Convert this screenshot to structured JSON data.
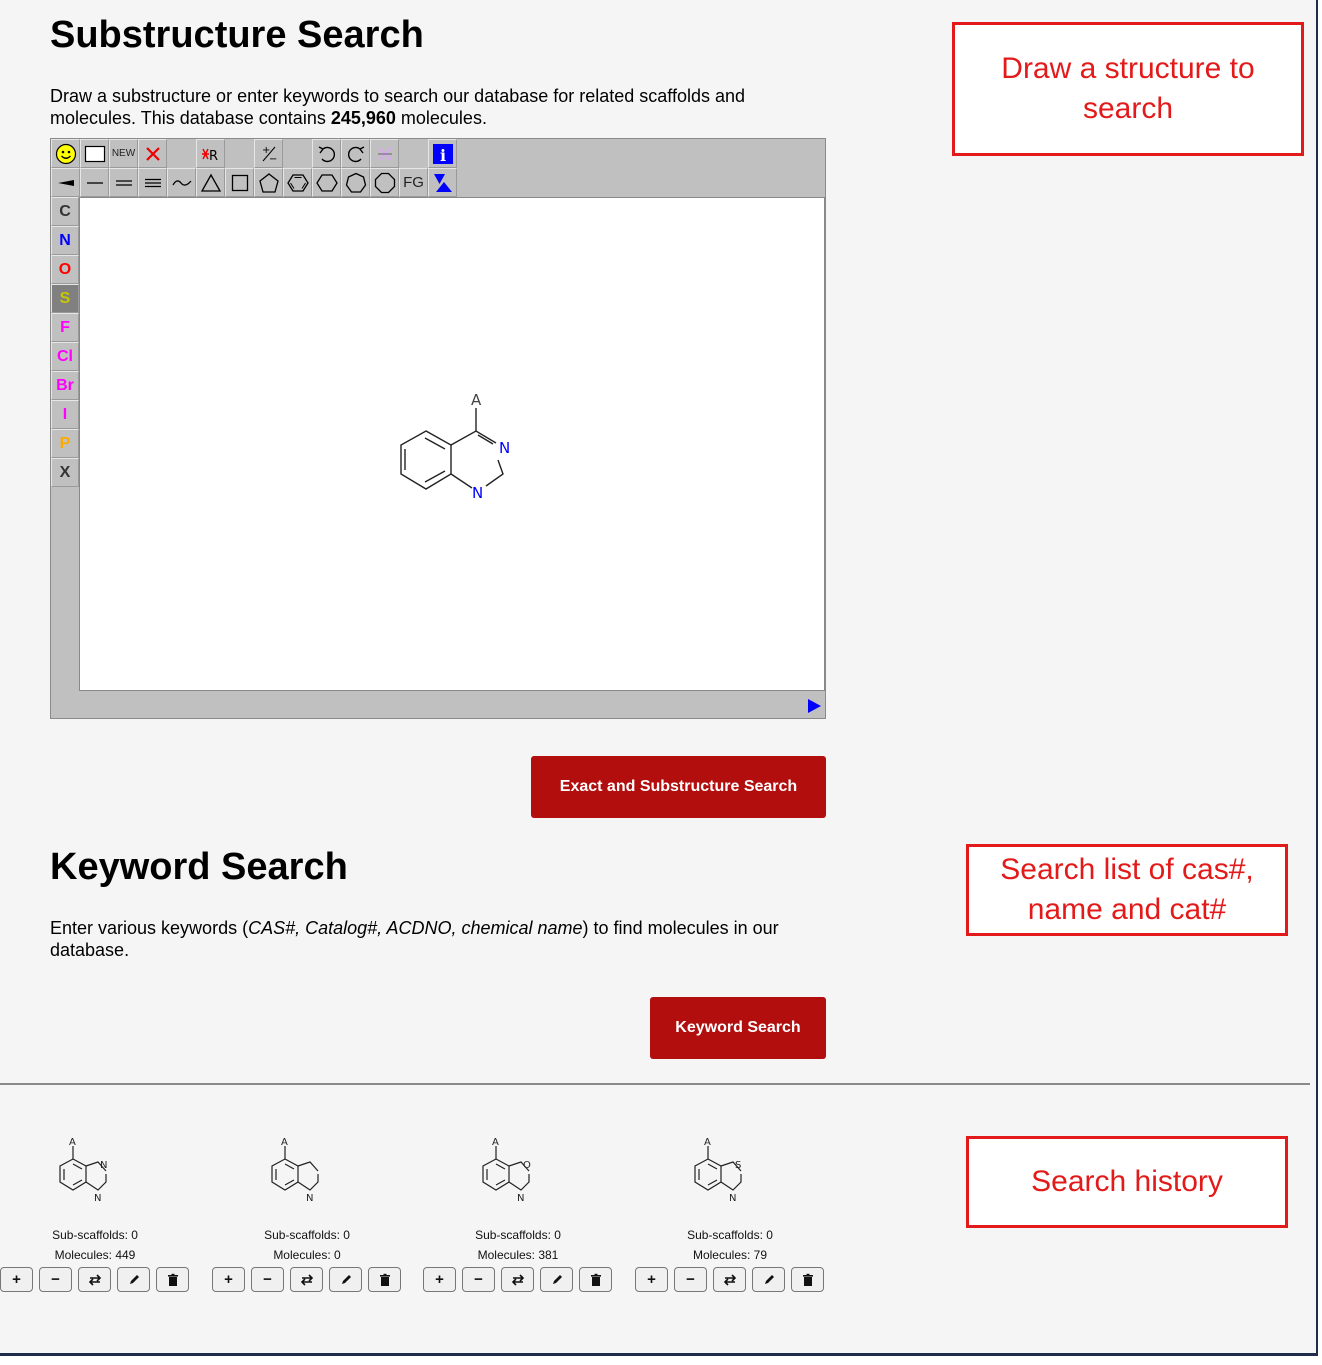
{
  "substructure": {
    "title": "Substructure Search",
    "desc_pre": "Draw a substructure or enter keywords to search our database for related scaffolds and molecules. This database contains ",
    "count": "245,960",
    "desc_post": " molecules.",
    "button": "Exact and Substructure Search"
  },
  "editor": {
    "toolbar_text": {
      "new": "NEW",
      "fg": "FG"
    },
    "elements": [
      {
        "symbol": "C",
        "color": "#333333"
      },
      {
        "symbol": "N",
        "color": "#0000ff"
      },
      {
        "symbol": "O",
        "color": "#ff0000"
      },
      {
        "symbol": "S",
        "color": "#c8c800"
      },
      {
        "symbol": "F",
        "color": "#ff00ff"
      },
      {
        "symbol": "Cl",
        "color": "#ff00ff"
      },
      {
        "symbol": "Br",
        "color": "#ff00ff"
      },
      {
        "symbol": "I",
        "color": "#ff00ff"
      },
      {
        "symbol": "P",
        "color": "#ffaa00"
      },
      {
        "symbol": "X",
        "color": "#333333"
      }
    ],
    "active_element": "S",
    "molecule_labels": {
      "attach": "A",
      "n1": "N",
      "n2": "N"
    }
  },
  "keyword": {
    "title": "Keyword Search",
    "desc_pre": "Enter various keywords (",
    "desc_italic": "CAS#, Catalog#, ACDNO, chemical name",
    "desc_post": ") to find molecules in our database.",
    "button": "Keyword Search"
  },
  "annotations": {
    "draw": "Draw a structure to search",
    "list": "Search list of cas#, name and cat#",
    "history": "Search history"
  },
  "history": [
    {
      "sub": "Sub-scaffolds: 0",
      "mol": "Molecules: 449",
      "ring": "imidazole",
      "labels": {
        "a": "A",
        "h1": "N",
        "h2": "N"
      }
    },
    {
      "sub": "Sub-scaffolds: 0",
      "mol": "Molecules: 0",
      "ring": "pyrroline",
      "labels": {
        "a": "A",
        "h1": "",
        "h2": "N"
      }
    },
    {
      "sub": "Sub-scaffolds: 0",
      "mol": "Molecules: 381",
      "ring": "oxazole",
      "labels": {
        "a": "A",
        "h1": "O",
        "h2": "N"
      }
    },
    {
      "sub": "Sub-scaffolds: 0",
      "mol": "Molecules: 79",
      "ring": "thiazole",
      "labels": {
        "a": "A",
        "h1": "S",
        "h2": "N"
      }
    }
  ],
  "colors": {
    "accent": "#b30e0e",
    "annotation": "#e31a1a",
    "nitrogen": "#0000ff"
  }
}
